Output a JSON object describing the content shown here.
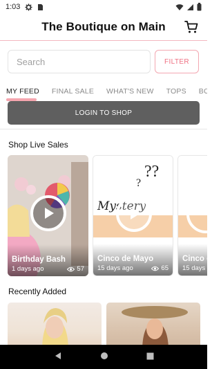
{
  "status_bar": {
    "time": "1:03"
  },
  "header": {
    "title": "The Boutique on Main"
  },
  "search": {
    "placeholder": "Search",
    "filter_label": "FILTER"
  },
  "tabs": [
    {
      "label": "MY FEED",
      "active": true
    },
    {
      "label": "FINAL SALE"
    },
    {
      "label": "WHAT'S NEW"
    },
    {
      "label": "TOPS"
    },
    {
      "label": "BOTT"
    }
  ],
  "login": {
    "label": "LOGIN TO SHOP"
  },
  "live_section": {
    "title": "Shop Live Sales",
    "cards": [
      {
        "name": "Birthday Bash",
        "age": "1 days ago",
        "views": "57"
      },
      {
        "name": "Cinco de Mayo",
        "age": "15 days ago",
        "views": "65"
      },
      {
        "name": "Cinco d",
        "age": "15 days"
      }
    ],
    "art_text": "Mystery"
  },
  "recent_section": {
    "title": "Recently Added"
  },
  "colors": {
    "accent": "#ef6e80",
    "accent_light": "#f5a5ae",
    "login_bg": "#5f5f5f"
  },
  "icons": [
    "settings-icon",
    "sim-icon",
    "wifi-icon",
    "signal-icon",
    "battery-icon",
    "cart-icon",
    "play-icon",
    "eye-icon",
    "back-icon",
    "home-icon",
    "recents-icon"
  ]
}
